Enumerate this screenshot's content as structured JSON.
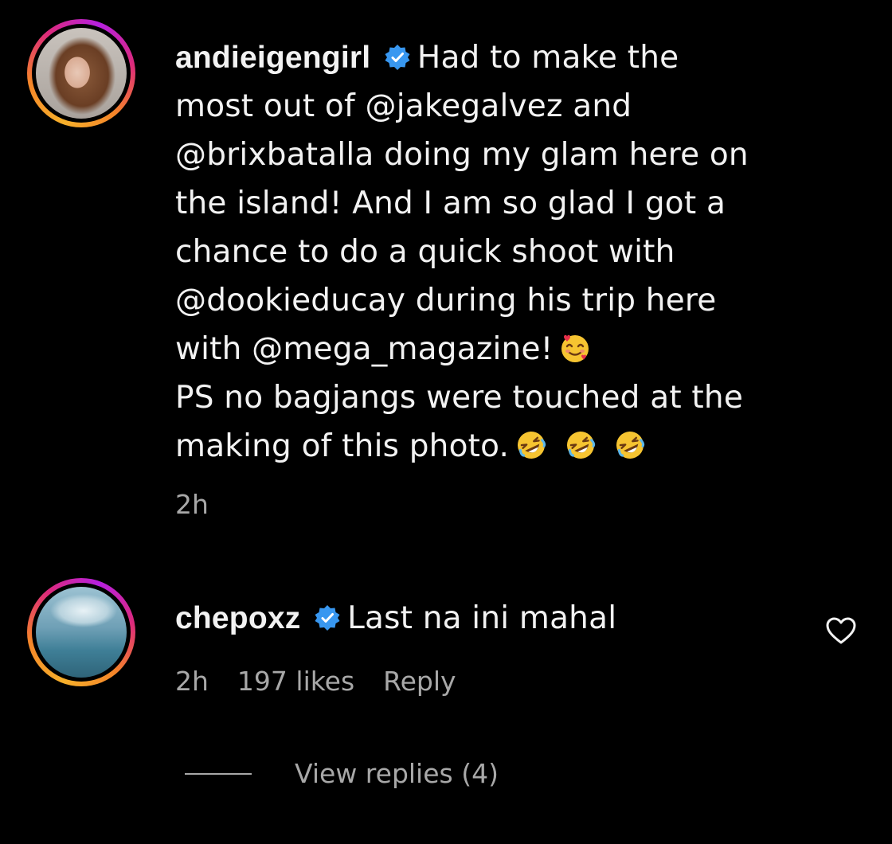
{
  "comments": [
    {
      "username": "andieigengirl",
      "verified": true,
      "text_lines": [
        "Had to make the",
        "most out of @jakegalvez and",
        "@brixbatalla doing my glam here on",
        "the island! And I am so glad I got a",
        "chance to do a quick shoot with",
        "@dookieducay during his trip here",
        "with @mega_magazine!",
        "PS no bagjangs were touched at the",
        "making of this photo."
      ],
      "emojis": [
        "smiling-face-with-hearts",
        "rolling-on-floor-laughing",
        "rolling-on-floor-laughing",
        "rolling-on-floor-laughing"
      ],
      "time": "2h"
    },
    {
      "username": "chepoxz",
      "verified": true,
      "text": "Last na ini mahal",
      "time": "2h",
      "likes": "197 likes",
      "reply_label": "Reply"
    }
  ],
  "view_replies": "View replies (4)",
  "colors": {
    "background": "#000000",
    "text": "#f2f2f2",
    "meta": "#a8a8a8",
    "verified": "#3897f0"
  }
}
